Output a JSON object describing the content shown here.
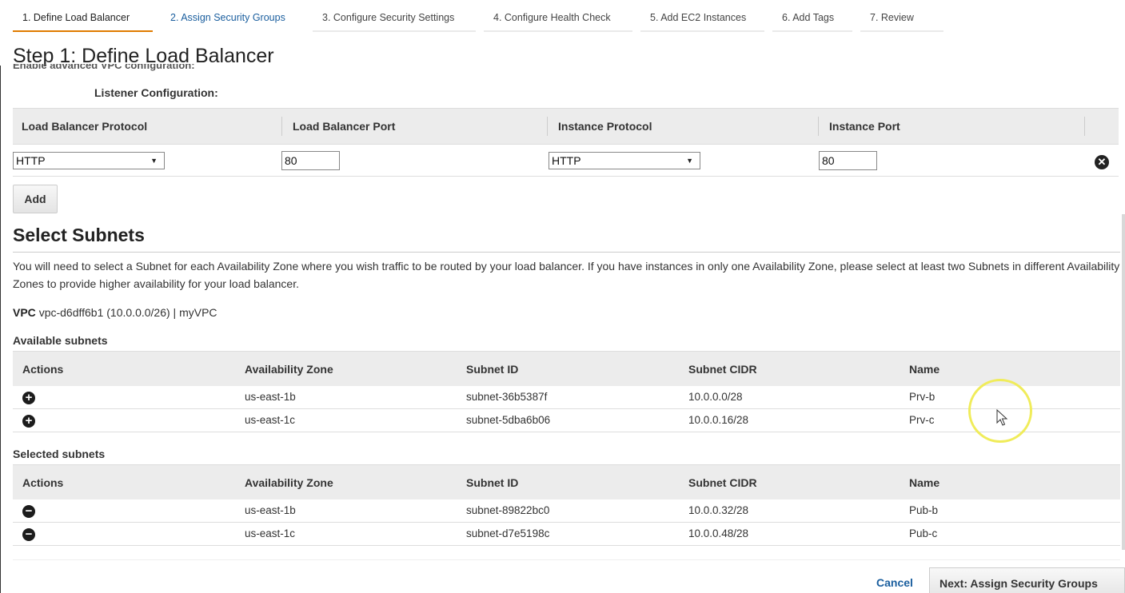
{
  "wizard": {
    "tabs": [
      {
        "label": "1. Define Load Balancer"
      },
      {
        "label": "2. Assign Security Groups"
      },
      {
        "label": "3. Configure Security Settings"
      },
      {
        "label": "4. Configure Health Check"
      },
      {
        "label": "5. Add EC2 Instances"
      },
      {
        "label": "6. Add Tags"
      },
      {
        "label": "7. Review"
      }
    ]
  },
  "page": {
    "title": "Step 1: Define Load Balancer",
    "cutoff_text": "Enable advanced VPC configuration:"
  },
  "listener": {
    "label": "Listener Configuration:",
    "headers": [
      "Load Balancer Protocol",
      "Load Balancer Port",
      "Instance Protocol",
      "Instance Port"
    ],
    "row": {
      "lb_protocol": "HTTP",
      "lb_port": "80",
      "instance_protocol": "HTTP",
      "instance_port": "80"
    },
    "add_label": "Add"
  },
  "subnets": {
    "title": "Select Subnets",
    "description": "You will need to select a Subnet for each Availability Zone where you wish traffic to be routed by your load balancer. If you have instances in only one Availability Zone, please select at least two Subnets in different Availability Zones to provide higher availability for your load balancer.",
    "vpc_label": "VPC",
    "vpc_value": "vpc-d6dff6b1 (10.0.0.0/26) | myVPC",
    "headers": [
      "Actions",
      "Availability Zone",
      "Subnet ID",
      "Subnet CIDR",
      "Name"
    ],
    "available_label": "Available subnets",
    "available": [
      {
        "zone": "us-east-1b",
        "id": "subnet-36b5387f",
        "cidr": "10.0.0.0/28",
        "name": "Prv-b"
      },
      {
        "zone": "us-east-1c",
        "id": "subnet-5dba6b06",
        "cidr": "10.0.0.16/28",
        "name": "Prv-c"
      }
    ],
    "selected_label": "Selected subnets",
    "selected": [
      {
        "zone": "us-east-1b",
        "id": "subnet-89822bc0",
        "cidr": "10.0.0.32/28",
        "name": "Pub-b"
      },
      {
        "zone": "us-east-1c",
        "id": "subnet-d7e5198c",
        "cidr": "10.0.0.48/28",
        "name": "Pub-c"
      }
    ]
  },
  "footer": {
    "cancel_label": "Cancel",
    "next_label": "Next: Assign Security Groups"
  },
  "colors": {
    "active_tab": "#e07b00",
    "link": "#1a5e9e",
    "header_bg": "#ececec"
  }
}
